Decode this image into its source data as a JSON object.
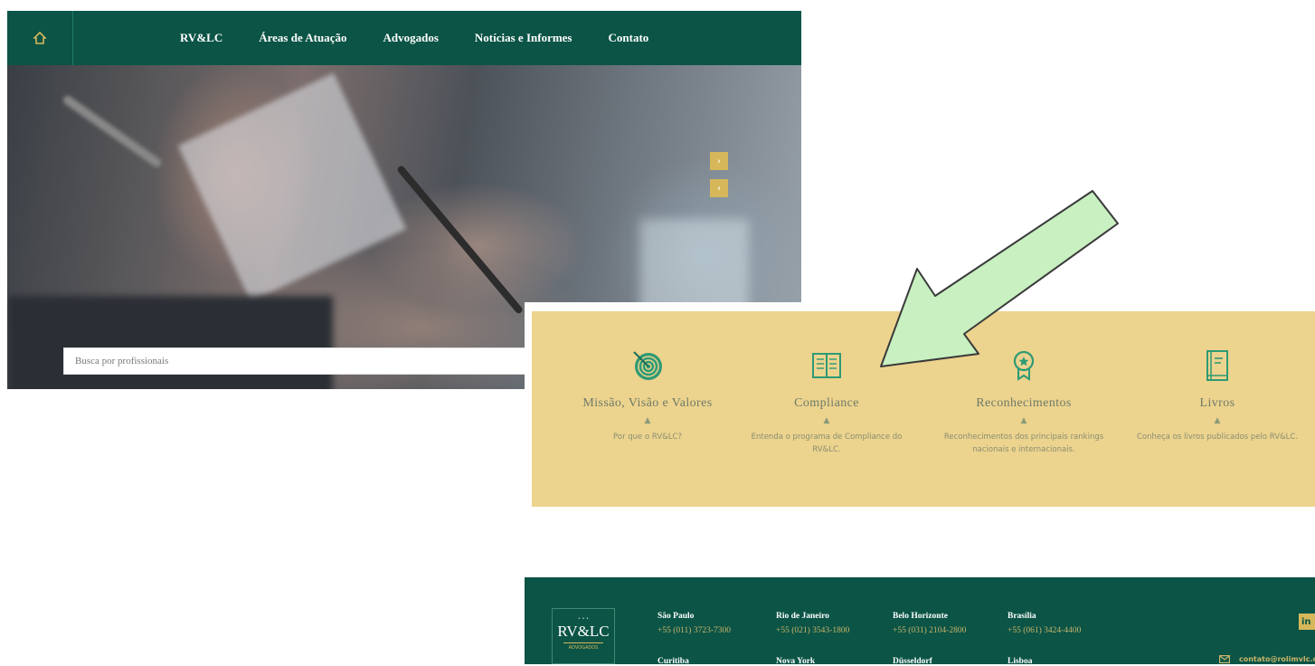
{
  "nav": {
    "home_icon": "home-icon",
    "items": [
      "RV&LC",
      "Áreas de Atuação",
      "Advogados",
      "Notícias e Informes",
      "Contato"
    ]
  },
  "hero": {
    "next_label": "›",
    "prev_label": "‹",
    "search_placeholder": "Busca por profissionais"
  },
  "features": [
    {
      "icon": "target-icon",
      "title": "Missão, Visão e Valores",
      "caret": "▲",
      "description": "Por que o RV&LC?"
    },
    {
      "icon": "open-book-icon",
      "title": "Compliance",
      "caret": "▲",
      "description": "Entenda o programa de Compliance do RV&LC."
    },
    {
      "icon": "award-ribbon-icon",
      "title": "Reconhecimentos",
      "caret": "▲",
      "description": "Reconhecimentos dos principais rankings nacionais e internacionais."
    },
    {
      "icon": "book-icon",
      "title": "Livros",
      "caret": "▲",
      "description": "Conheça os livros publicados pelo RV&LC."
    }
  ],
  "footer": {
    "logo_text": "RV&LC",
    "logo_tagline": "ADVOGADOS",
    "offices": [
      {
        "city": "São Paulo",
        "phone": "+55 (011) 3723-7300"
      },
      {
        "city": "Rio de Janeiro",
        "phone": "+55 (021) 3543-1800"
      },
      {
        "city": "Belo Horizonte",
        "phone": "+55 (031) 2104-2800"
      },
      {
        "city": "Brasília",
        "phone": "+55 (061) 3424-4400"
      },
      {
        "city": "Curitiba"
      },
      {
        "city": "Nova York"
      },
      {
        "city": "Düsseldorf"
      },
      {
        "city": "Lisboa"
      }
    ],
    "linkedin_label": "in",
    "email": "contato@rolimvlc.com"
  },
  "colors": {
    "brand_green": "#0b5446",
    "gold": "#d6b85a",
    "panel_yellow": "#ecd38e",
    "annotation_arrow": "#c8f0c0"
  }
}
